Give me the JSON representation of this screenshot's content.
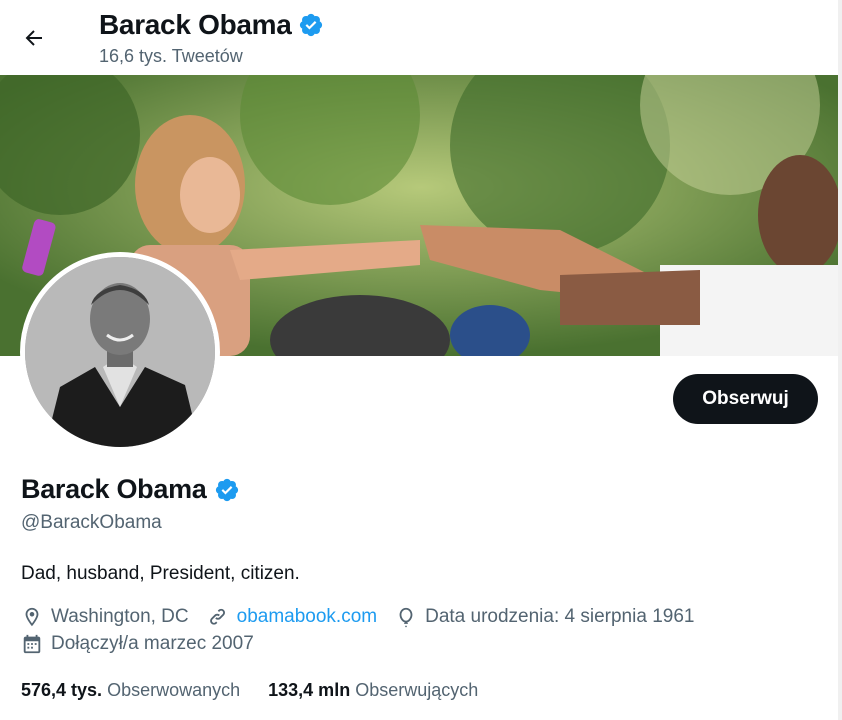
{
  "header": {
    "name": "Barack Obama",
    "tweet_count": "16,6 tys. Tweetów"
  },
  "profile": {
    "name": "Barack Obama",
    "handle": "@BarackObama",
    "bio": "Dad, husband, President, citizen.",
    "location": "Washington, DC",
    "website": "obamabook.com",
    "birthday": "Data urodzenia: 4 sierpnia 1961",
    "joined": "Dołączył/a marzec 2007",
    "follow_label": "Obserwuj"
  },
  "stats": {
    "following_count": "576,4 tys.",
    "following_label": "Obserwowanych",
    "followers_count": "133,4 mln",
    "followers_label": "Obserwujących"
  },
  "colors": {
    "verified": "#1d9bf0",
    "link": "#1d9bf0",
    "follow_button": "#0f1419",
    "secondary_text": "#536471"
  },
  "icons": [
    "back-arrow-icon",
    "verified-badge-icon",
    "location-icon",
    "link-icon",
    "balloon-icon",
    "calendar-icon"
  ]
}
